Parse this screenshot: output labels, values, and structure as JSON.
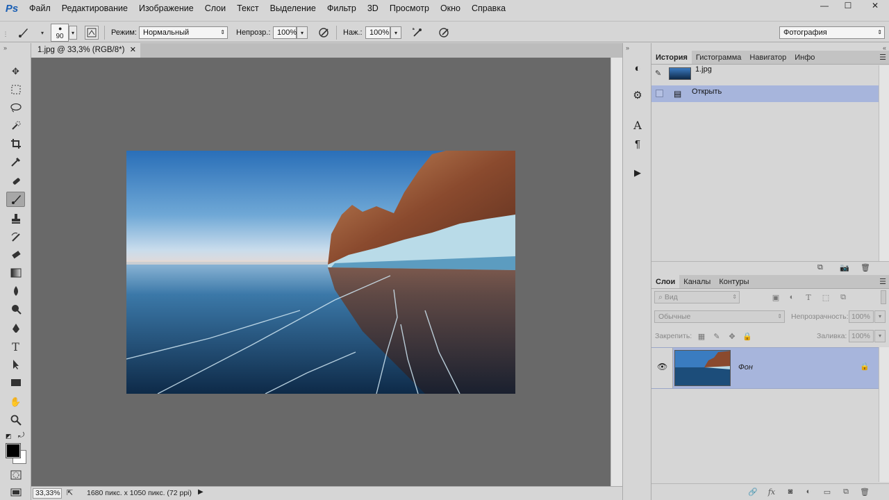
{
  "app": {
    "logo": "Ps"
  },
  "menu": [
    "Файл",
    "Редактирование",
    "Изображение",
    "Слои",
    "Текст",
    "Выделение",
    "Фильтр",
    "3D",
    "Просмотр",
    "Окно",
    "Справка"
  ],
  "window_controls": {
    "minimize": "—",
    "maximize": "☐",
    "close": "✕"
  },
  "options": {
    "brush_size": "90",
    "mode_label": "Режим:",
    "mode_value": "Нормальный",
    "opacity_label": "Непрозр.:",
    "opacity_value": "100%",
    "pressure_label": "Наж.:",
    "pressure_value": "100%",
    "workspace": "Фотография"
  },
  "document": {
    "tab_title": "1.jpg @ 33,3% (RGB/8*)",
    "zoom": "33,33%",
    "info": "1680 пикс. x 1050 пикс. (72 ppi)"
  },
  "history_panel": {
    "tabs": [
      "История",
      "Гистограмма",
      "Навигатор",
      "Инфо"
    ],
    "snapshot": "1.jpg",
    "steps": [
      "Открыть"
    ]
  },
  "layers_panel": {
    "tabs": [
      "Слои",
      "Каналы",
      "Контуры"
    ],
    "filter_placeholder": "Вид",
    "blend_mode": "Обычные",
    "opacity_label": "Непрозрачность:",
    "opacity_value": "100%",
    "lock_label": "Закрепить:",
    "fill_label": "Заливка:",
    "fill_value": "100%",
    "layers": [
      {
        "name": "Фон"
      }
    ]
  },
  "colors": {
    "accent_selection": "#a7b5dc",
    "canvas_bg": "#696969",
    "chrome": "#d6d6d6"
  }
}
